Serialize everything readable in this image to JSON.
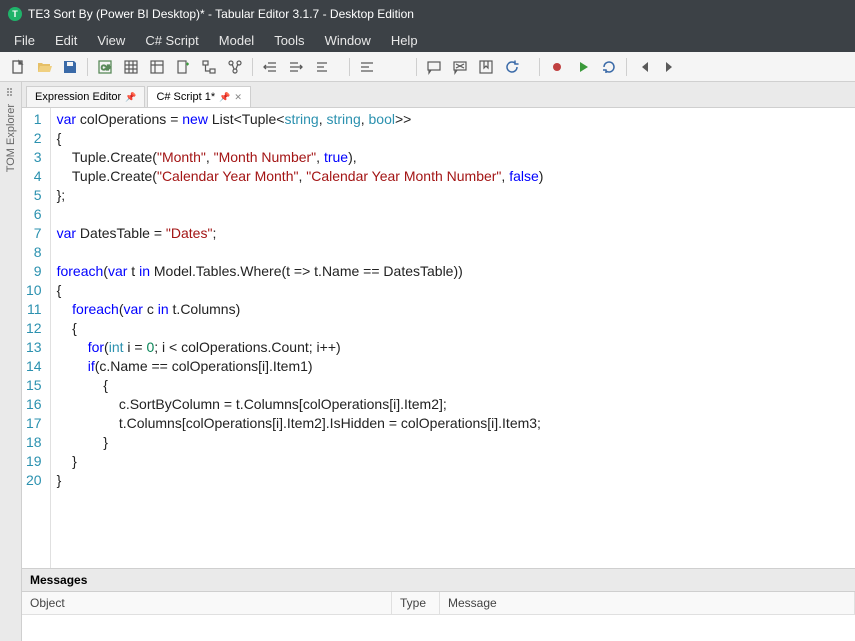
{
  "titlebar": {
    "icon_letter": "T",
    "text": "TE3 Sort By (Power BI Desktop)* - Tabular Editor 3.1.7 - Desktop Edition"
  },
  "menubar": [
    "File",
    "Edit",
    "View",
    "C# Script",
    "Model",
    "Tools",
    "Window",
    "Help"
  ],
  "side_tab": {
    "label": "TOM Explorer"
  },
  "tabs": [
    {
      "label": "Expression Editor",
      "pinned": true,
      "closable": false
    },
    {
      "label": "C# Script 1*",
      "pinned": true,
      "closable": true
    }
  ],
  "active_tab": 1,
  "code_lines": [
    [
      {
        "t": "kw",
        "v": "var"
      },
      {
        "t": "",
        "v": " colOperations = "
      },
      {
        "t": "kw",
        "v": "new"
      },
      {
        "t": "",
        "v": " List<Tuple<"
      },
      {
        "t": "type",
        "v": "string"
      },
      {
        "t": "",
        "v": ", "
      },
      {
        "t": "type",
        "v": "string"
      },
      {
        "t": "",
        "v": ", "
      },
      {
        "t": "type",
        "v": "bool"
      },
      {
        "t": "",
        "v": ">>"
      }
    ],
    [
      {
        "t": "",
        "v": "{"
      }
    ],
    [
      {
        "t": "",
        "v": "    Tuple.Create("
      },
      {
        "t": "str",
        "v": "\"Month\""
      },
      {
        "t": "",
        "v": ", "
      },
      {
        "t": "str",
        "v": "\"Month Number\""
      },
      {
        "t": "",
        "v": ", "
      },
      {
        "t": "bool",
        "v": "true"
      },
      {
        "t": "",
        "v": "),"
      }
    ],
    [
      {
        "t": "",
        "v": "    Tuple.Create("
      },
      {
        "t": "str",
        "v": "\"Calendar Year Month\""
      },
      {
        "t": "",
        "v": ", "
      },
      {
        "t": "str",
        "v": "\"Calendar Year Month Number\""
      },
      {
        "t": "",
        "v": ", "
      },
      {
        "t": "bool",
        "v": "false"
      },
      {
        "t": "",
        "v": ")"
      }
    ],
    [
      {
        "t": "",
        "v": "};"
      }
    ],
    [
      {
        "t": "",
        "v": ""
      }
    ],
    [
      {
        "t": "kw",
        "v": "var"
      },
      {
        "t": "",
        "v": " DatesTable = "
      },
      {
        "t": "str",
        "v": "\"Dates\""
      },
      {
        "t": "",
        "v": ";"
      }
    ],
    [
      {
        "t": "",
        "v": ""
      }
    ],
    [
      {
        "t": "kw",
        "v": "foreach"
      },
      {
        "t": "",
        "v": "("
      },
      {
        "t": "kw",
        "v": "var"
      },
      {
        "t": "",
        "v": " t "
      },
      {
        "t": "kw",
        "v": "in"
      },
      {
        "t": "",
        "v": " Model.Tables.Where(t => t.Name == DatesTable))"
      }
    ],
    [
      {
        "t": "",
        "v": "{"
      }
    ],
    [
      {
        "t": "",
        "v": "    "
      },
      {
        "t": "kw",
        "v": "foreach"
      },
      {
        "t": "",
        "v": "("
      },
      {
        "t": "kw",
        "v": "var"
      },
      {
        "t": "",
        "v": " c "
      },
      {
        "t": "kw",
        "v": "in"
      },
      {
        "t": "",
        "v": " t.Columns)"
      }
    ],
    [
      {
        "t": "",
        "v": "    {"
      }
    ],
    [
      {
        "t": "",
        "v": "        "
      },
      {
        "t": "kw",
        "v": "for"
      },
      {
        "t": "",
        "v": "("
      },
      {
        "t": "type",
        "v": "int"
      },
      {
        "t": "",
        "v": " i = "
      },
      {
        "t": "num",
        "v": "0"
      },
      {
        "t": "",
        "v": "; i < colOperations.Count; i++)"
      }
    ],
    [
      {
        "t": "",
        "v": "        "
      },
      {
        "t": "kw",
        "v": "if"
      },
      {
        "t": "",
        "v": "(c.Name == colOperations[i].Item1)"
      }
    ],
    [
      {
        "t": "",
        "v": "            {"
      }
    ],
    [
      {
        "t": "",
        "v": "                c.SortByColumn = t.Columns[colOperations[i].Item2];"
      }
    ],
    [
      {
        "t": "",
        "v": "                t.Columns[colOperations[i].Item2].IsHidden = colOperations[i].Item3;"
      }
    ],
    [
      {
        "t": "",
        "v": "            }"
      }
    ],
    [
      {
        "t": "",
        "v": "    }"
      }
    ],
    [
      {
        "t": "",
        "v": "}"
      }
    ]
  ],
  "messages": {
    "title": "Messages",
    "columns": {
      "object": "Object",
      "type": "Type",
      "message": "Message"
    }
  }
}
